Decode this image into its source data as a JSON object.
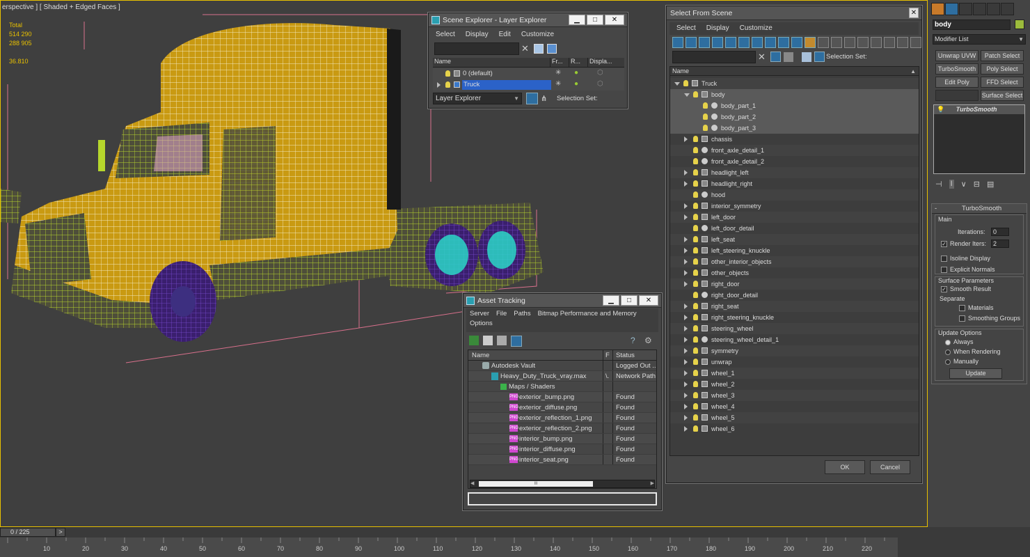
{
  "viewport": {
    "label": "erspective ] [ Shaded + Edged Faces ]",
    "stats": {
      "total_label": "Total",
      "polys": "514 290",
      "verts": "288 905",
      "fps": "36.810"
    }
  },
  "layer_explorer": {
    "title": "Scene Explorer - Layer Explorer",
    "menu": [
      "Select",
      "Display",
      "Edit",
      "Customize"
    ],
    "columns": [
      "Name",
      "Fr...",
      "R...",
      "Displa..."
    ],
    "rows": [
      {
        "label": "0 (default)",
        "selected": false
      },
      {
        "label": "Truck",
        "selected": true
      }
    ],
    "footer_dropdown": "Layer Explorer",
    "selection_set_label": "Selection Set:"
  },
  "select_from_scene": {
    "title": "Select From Scene",
    "menu": [
      "Select",
      "Display",
      "Customize"
    ],
    "selection_set_label": "Selection Set:",
    "column_name": "Name",
    "tree": [
      {
        "label": "Truck",
        "depth": 0,
        "expand": "down",
        "icon": "group",
        "sel": false
      },
      {
        "label": "body",
        "depth": 1,
        "expand": "down",
        "icon": "group",
        "sel": true
      },
      {
        "label": "body_part_1",
        "depth": 2,
        "expand": "none",
        "icon": "mesh",
        "sel": true
      },
      {
        "label": "body_part_2",
        "depth": 2,
        "expand": "none",
        "icon": "mesh",
        "sel": true
      },
      {
        "label": "body_part_3",
        "depth": 2,
        "expand": "none",
        "icon": "mesh",
        "sel": true
      },
      {
        "label": "chassis",
        "depth": 1,
        "expand": "right",
        "icon": "group",
        "sel": false
      },
      {
        "label": "front_axle_detail_1",
        "depth": 1,
        "expand": "none",
        "icon": "mesh",
        "sel": false
      },
      {
        "label": "front_axle_detail_2",
        "depth": 1,
        "expand": "none",
        "icon": "mesh",
        "sel": false
      },
      {
        "label": "headlight_left",
        "depth": 1,
        "expand": "right",
        "icon": "group",
        "sel": false
      },
      {
        "label": "headlight_right",
        "depth": 1,
        "expand": "right",
        "icon": "group",
        "sel": false
      },
      {
        "label": "hood",
        "depth": 1,
        "expand": "none",
        "icon": "mesh",
        "sel": false
      },
      {
        "label": "interior_symmetry",
        "depth": 1,
        "expand": "right",
        "icon": "group",
        "sel": false
      },
      {
        "label": "left_door",
        "depth": 1,
        "expand": "right",
        "icon": "group",
        "sel": false
      },
      {
        "label": "left_door_detail",
        "depth": 1,
        "expand": "none",
        "icon": "mesh",
        "sel": false
      },
      {
        "label": "left_seat",
        "depth": 1,
        "expand": "right",
        "icon": "group",
        "sel": false
      },
      {
        "label": "left_steering_knuckle",
        "depth": 1,
        "expand": "right",
        "icon": "group",
        "sel": false
      },
      {
        "label": "other_interior_objects",
        "depth": 1,
        "expand": "right",
        "icon": "group",
        "sel": false
      },
      {
        "label": "other_objects",
        "depth": 1,
        "expand": "right",
        "icon": "group",
        "sel": false
      },
      {
        "label": "right_door",
        "depth": 1,
        "expand": "right",
        "icon": "group",
        "sel": false
      },
      {
        "label": "right_door_detail",
        "depth": 1,
        "expand": "none",
        "icon": "mesh",
        "sel": false
      },
      {
        "label": "right_seat",
        "depth": 1,
        "expand": "right",
        "icon": "group",
        "sel": false
      },
      {
        "label": "right_steering_knuckle",
        "depth": 1,
        "expand": "right",
        "icon": "group",
        "sel": false
      },
      {
        "label": "steering_wheel",
        "depth": 1,
        "expand": "right",
        "icon": "group",
        "sel": false
      },
      {
        "label": "steering_wheel_detail_1",
        "depth": 1,
        "expand": "right",
        "icon": "mesh",
        "sel": false
      },
      {
        "label": "symmetry",
        "depth": 1,
        "expand": "right",
        "icon": "group",
        "sel": false
      },
      {
        "label": "unwrap",
        "depth": 1,
        "expand": "right",
        "icon": "group",
        "sel": false
      },
      {
        "label": "wheel_1",
        "depth": 1,
        "expand": "right",
        "icon": "group",
        "sel": false
      },
      {
        "label": "wheel_2",
        "depth": 1,
        "expand": "right",
        "icon": "group",
        "sel": false
      },
      {
        "label": "wheel_3",
        "depth": 1,
        "expand": "right",
        "icon": "group",
        "sel": false
      },
      {
        "label": "wheel_4",
        "depth": 1,
        "expand": "right",
        "icon": "group",
        "sel": false
      },
      {
        "label": "wheel_5",
        "depth": 1,
        "expand": "right",
        "icon": "group",
        "sel": false
      },
      {
        "label": "wheel_6",
        "depth": 1,
        "expand": "right",
        "icon": "group",
        "sel": false
      }
    ],
    "ok_label": "OK",
    "cancel_label": "Cancel"
  },
  "asset_tracking": {
    "title": "Asset Tracking",
    "menu": [
      "Server",
      "File",
      "Paths",
      "Bitmap Performance and Memory"
    ],
    "menu2": "Options",
    "columns": [
      "Name",
      "F",
      "Status"
    ],
    "rows": [
      {
        "name": "Autodesk Vault",
        "f": "",
        "status": "Logged Out ...",
        "indent": 0,
        "kind": "vault"
      },
      {
        "name": "Heavy_Duty_Truck_vray.max",
        "f": "\\.",
        "status": "Network Path",
        "indent": 1,
        "kind": "max"
      },
      {
        "name": "Maps / Shaders",
        "f": "",
        "status": "",
        "indent": 2,
        "kind": "maps"
      },
      {
        "name": "exterior_bump.png",
        "f": "",
        "status": "Found",
        "indent": 3,
        "kind": "png"
      },
      {
        "name": "exterior_diffuse.png",
        "f": "",
        "status": "Found",
        "indent": 3,
        "kind": "png"
      },
      {
        "name": "exterior_reflection_1.png",
        "f": "",
        "status": "Found",
        "indent": 3,
        "kind": "png"
      },
      {
        "name": "exterior_reflection_2.png",
        "f": "",
        "status": "Found",
        "indent": 3,
        "kind": "png"
      },
      {
        "name": "interior_bump.png",
        "f": "",
        "status": "Found",
        "indent": 3,
        "kind": "png"
      },
      {
        "name": "interior_diffuse.png",
        "f": "",
        "status": "Found",
        "indent": 3,
        "kind": "png"
      },
      {
        "name": "interior_seat.png",
        "f": "",
        "status": "Found",
        "indent": 3,
        "kind": "png"
      }
    ],
    "png_icon_text": "PNG",
    "scroll_grip": "III"
  },
  "command_panel": {
    "object_name": "body",
    "modifier_list": "Modifier List",
    "buttons": [
      "Unwrap UVW",
      "Patch Select",
      "TurboSmooth",
      "Poly Select",
      "Edit Poly",
      "FFD Select",
      "",
      "Surface Select"
    ],
    "stack_item": "TurboSmooth",
    "rollout_title": "TurboSmooth",
    "main_label": "Main",
    "iterations_label": "Iterations:",
    "iterations_value": "0",
    "render_iters_label": "Render Iters:",
    "render_iters_value": "2",
    "isoline_label": "Isoline Display",
    "explicit_normals_label": "Explicit Normals",
    "surface_params_label": "Surface Parameters",
    "smooth_result_label": "Smooth Result",
    "separate_label": "Separate",
    "materials_label": "Materials",
    "smoothing_groups_label": "Smoothing Groups",
    "update_options_label": "Update Options",
    "always_label": "Always",
    "when_rendering_label": "When Rendering",
    "manually_label": "Manually",
    "update_button": "Update",
    "accent_color": "#9cbb3c"
  },
  "timeline": {
    "frame_label": "0 / 225",
    "next_label": ">",
    "ticks": [
      "10",
      "20",
      "30",
      "40",
      "50",
      "60",
      "70",
      "80",
      "90",
      "100",
      "110",
      "120",
      "130",
      "140",
      "150",
      "160",
      "170",
      "180",
      "190",
      "200",
      "210",
      "220"
    ]
  }
}
